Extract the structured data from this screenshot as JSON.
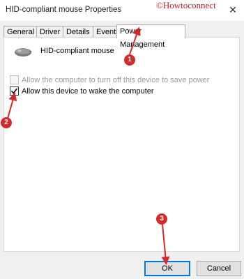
{
  "window": {
    "title": "HID-compliant mouse Properties",
    "watermark": "©Howtoconnect",
    "close_glyph": "✕"
  },
  "tabs": [
    {
      "label": "General",
      "active": false
    },
    {
      "label": "Driver",
      "active": false
    },
    {
      "label": "Details",
      "active": false
    },
    {
      "label": "Events",
      "active": false
    },
    {
      "label": "Power Management",
      "active": true
    }
  ],
  "device": {
    "icon": "mouse-icon",
    "name": "HID-compliant mouse"
  },
  "options": [
    {
      "label": "Allow the computer to turn off this device to save power",
      "checked": false,
      "enabled": false
    },
    {
      "label": "Allow this device to wake the computer",
      "checked": true,
      "enabled": true
    }
  ],
  "buttons": {
    "ok": "OK",
    "cancel": "Cancel"
  },
  "annotations": [
    "1",
    "2",
    "3"
  ],
  "colors": {
    "annotation_red": "#d62a2a",
    "watermark_red": "#c0232b",
    "focus_blue": "#0078d7"
  }
}
